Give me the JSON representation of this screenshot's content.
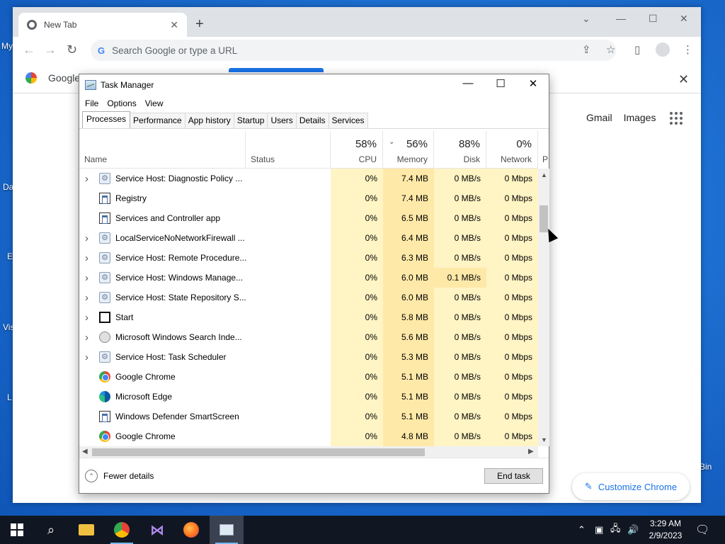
{
  "desktop": {
    "labels": [
      "My",
      "Da",
      "E",
      "Vis",
      "L",
      "Bin"
    ]
  },
  "chrome": {
    "tab_title": "New Tab",
    "omnibox_placeholder": "Search Google or type a URL",
    "bookmark_label": "Google",
    "ntp_links": [
      "Gmail",
      "Images"
    ],
    "customize_label": "Customize Chrome"
  },
  "taskmanager": {
    "title": "Task Manager",
    "menu": [
      "File",
      "Options",
      "View"
    ],
    "tabs": [
      "Processes",
      "Performance",
      "App history",
      "Startup",
      "Users",
      "Details",
      "Services"
    ],
    "columns": {
      "name": "Name",
      "status": "Status",
      "cpu": {
        "pct": "58%",
        "label": "CPU"
      },
      "memory": {
        "pct": "56%",
        "label": "Memory"
      },
      "disk": {
        "pct": "88%",
        "label": "Disk"
      },
      "network": {
        "pct": "0%",
        "label": "Network"
      },
      "power": "P"
    },
    "rows": [
      {
        "name": "Service Host: Diagnostic Policy ...",
        "cpu": "0%",
        "mem": "7.4 MB",
        "disk": "0 MB/s",
        "net": "0 Mbps",
        "icon": "gear-icon",
        "expandable": true
      },
      {
        "name": "Registry",
        "cpu": "0%",
        "mem": "7.4 MB",
        "disk": "0 MB/s",
        "net": "0 Mbps",
        "icon": "window-icon",
        "expandable": false
      },
      {
        "name": "Services and Controller app",
        "cpu": "0%",
        "mem": "6.5 MB",
        "disk": "0 MB/s",
        "net": "0 Mbps",
        "icon": "window-icon",
        "expandable": false
      },
      {
        "name": "LocalServiceNoNetworkFirewall ...",
        "cpu": "0%",
        "mem": "6.4 MB",
        "disk": "0 MB/s",
        "net": "0 Mbps",
        "icon": "gear-icon",
        "expandable": true
      },
      {
        "name": "Service Host: Remote Procedure...",
        "cpu": "0%",
        "mem": "6.3 MB",
        "disk": "0 MB/s",
        "net": "0 Mbps",
        "icon": "gear-icon",
        "expandable": true
      },
      {
        "name": "Service Host: Windows Manage...",
        "cpu": "0%",
        "mem": "6.0 MB",
        "disk": "0.1 MB/s",
        "net": "0 Mbps",
        "icon": "gear-icon",
        "expandable": true,
        "disk_hot": true
      },
      {
        "name": "Service Host: State Repository S...",
        "cpu": "0%",
        "mem": "6.0 MB",
        "disk": "0 MB/s",
        "net": "0 Mbps",
        "icon": "gear-icon",
        "expandable": true
      },
      {
        "name": "Start",
        "cpu": "0%",
        "mem": "5.8 MB",
        "disk": "0 MB/s",
        "net": "0 Mbps",
        "icon": "start-icon",
        "expandable": true
      },
      {
        "name": "Microsoft Windows Search Inde...",
        "cpu": "0%",
        "mem": "5.6 MB",
        "disk": "0 MB/s",
        "net": "0 Mbps",
        "icon": "search-indexer-icon",
        "expandable": true
      },
      {
        "name": "Service Host: Task Scheduler",
        "cpu": "0%",
        "mem": "5.3 MB",
        "disk": "0 MB/s",
        "net": "0 Mbps",
        "icon": "gear-icon",
        "expandable": true
      },
      {
        "name": "Google Chrome",
        "cpu": "0%",
        "mem": "5.1 MB",
        "disk": "0 MB/s",
        "net": "0 Mbps",
        "icon": "chrome-icon",
        "expandable": false
      },
      {
        "name": "Microsoft Edge",
        "cpu": "0%",
        "mem": "5.1 MB",
        "disk": "0 MB/s",
        "net": "0 Mbps",
        "icon": "edge-icon",
        "expandable": false
      },
      {
        "name": "Windows Defender SmartScreen",
        "cpu": "0%",
        "mem": "5.1 MB",
        "disk": "0 MB/s",
        "net": "0 Mbps",
        "icon": "window-icon",
        "expandable": false
      },
      {
        "name": "Google Chrome",
        "cpu": "0%",
        "mem": "4.8 MB",
        "disk": "0 MB/s",
        "net": "0 Mbps",
        "icon": "chrome-icon",
        "expandable": false
      }
    ],
    "fewer_details": "Fewer details",
    "end_task": "End task"
  },
  "taskbar": {
    "time": "3:29 AM",
    "date": "2/9/2023"
  }
}
